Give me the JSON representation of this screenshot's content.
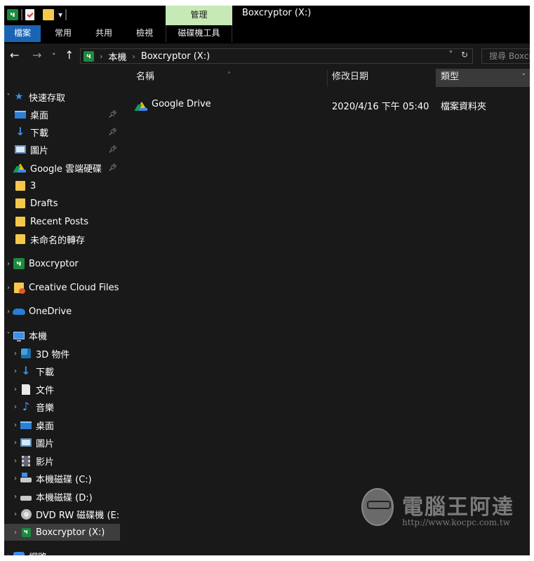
{
  "window": {
    "title": "Boxcryptor (X:)",
    "contextual_tab": "管理",
    "logo_glyph": "ч"
  },
  "ribbon": {
    "tabs": [
      "檔案",
      "常用",
      "共用",
      "檢視",
      "磁碟機工具"
    ],
    "active_tab": "檔案"
  },
  "address": {
    "crumbs": [
      "本機",
      "Boxcryptor (X:)"
    ],
    "search_placeholder": "搜尋 Boxcr"
  },
  "nav": {
    "quick_access": {
      "label": "快速存取",
      "items": [
        {
          "label": "桌面",
          "icon": "desktop-icon",
          "pinned": true
        },
        {
          "label": "下載",
          "icon": "downloads-icon",
          "pinned": true
        },
        {
          "label": "圖片",
          "icon": "pictures-icon",
          "pinned": true
        },
        {
          "label": "Google 雲端硬碟",
          "icon": "google-drive-icon",
          "pinned": true
        },
        {
          "label": "3",
          "icon": "folder-icon",
          "pinned": false
        },
        {
          "label": "Drafts",
          "icon": "folder-icon",
          "pinned": false
        },
        {
          "label": "Recent Posts",
          "icon": "folder-icon",
          "pinned": false
        },
        {
          "label": "未命名的轉存",
          "icon": "folder-icon",
          "pinned": false
        }
      ]
    },
    "roots": [
      {
        "label": "Boxcryptor",
        "icon": "boxcryptor-icon"
      },
      {
        "label": "Creative Cloud Files",
        "icon": "creative-cloud-icon"
      },
      {
        "label": "OneDrive",
        "icon": "onedrive-icon"
      }
    ],
    "this_pc": {
      "label": "本機",
      "items": [
        {
          "label": "3D 物件",
          "icon": "3d-objects-icon"
        },
        {
          "label": "下載",
          "icon": "downloads-icon"
        },
        {
          "label": "文件",
          "icon": "documents-icon"
        },
        {
          "label": "音樂",
          "icon": "music-icon"
        },
        {
          "label": "桌面",
          "icon": "desktop-icon"
        },
        {
          "label": "圖片",
          "icon": "pictures-icon"
        },
        {
          "label": "影片",
          "icon": "videos-icon"
        },
        {
          "label": "本機磁碟 (C:)",
          "icon": "local-disk-icon"
        },
        {
          "label": "本機磁碟 (D:)",
          "icon": "local-disk-icon"
        },
        {
          "label": "DVD RW 磁碟機 (E:",
          "icon": "dvd-drive-icon"
        },
        {
          "label": "Boxcryptor (X:)",
          "icon": "boxcryptor-drive-icon",
          "selected": true
        }
      ]
    },
    "network": {
      "label": "網路",
      "icon": "network-icon"
    }
  },
  "columns": [
    "名稱",
    "修改日期",
    "類型"
  ],
  "files": [
    {
      "name": "Google Drive",
      "modified": "2020/4/16 下午 05:40",
      "type": "檔案資料夾",
      "icon": "google-drive-icon"
    }
  ],
  "watermark": {
    "name": "電腦王阿達",
    "url": "http://www.kocpc.com.tw"
  },
  "colors": {
    "background": "#191919",
    "ribbon_active": "#1a64b4",
    "contextual_tab": "#c7e9b5",
    "selection": "#3d3d3d"
  }
}
